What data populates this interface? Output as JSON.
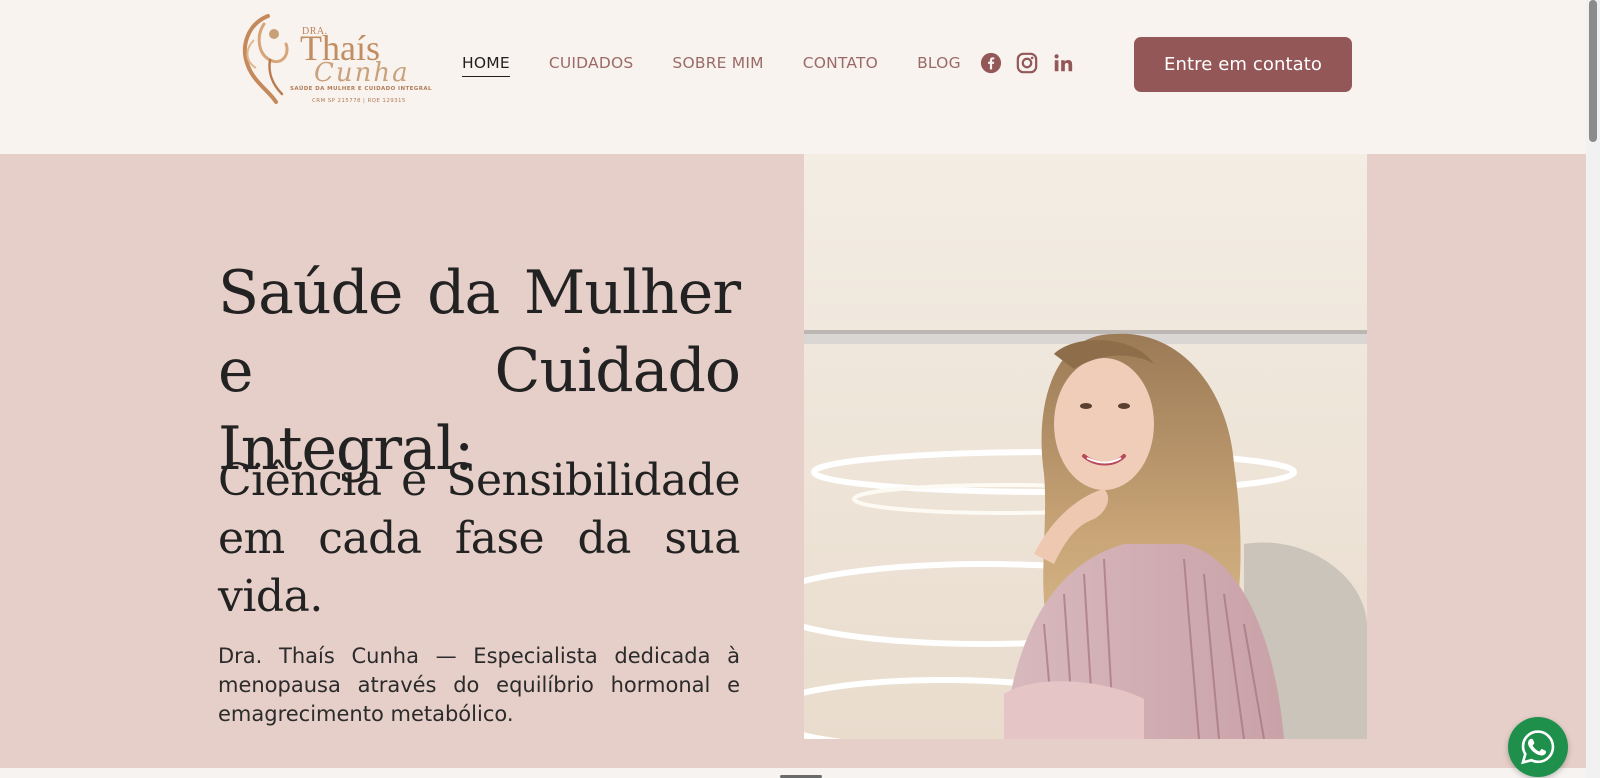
{
  "logo": {
    "prefix": "DRA.",
    "name": "Thaís",
    "surname": "Cunha",
    "tagline": "SAÚDE DA MULHER E CUIDADO INTEGRAL",
    "registration": "CRM SP 215778 | RQE 129315"
  },
  "nav": {
    "items": [
      {
        "label": "HOME",
        "active": true
      },
      {
        "label": "CUIDADOS",
        "active": false
      },
      {
        "label": "SOBRE MIM",
        "active": false
      },
      {
        "label": "CONTATO",
        "active": false
      },
      {
        "label": "BLOG",
        "active": false
      }
    ]
  },
  "socials": [
    "facebook-icon",
    "instagram-icon",
    "linkedin-icon"
  ],
  "header": {
    "cta_label": "Entre em contato"
  },
  "hero": {
    "title": "Saúde da Mulher e Cuidado Integral:",
    "subtitle": "Ciência e Sensibilidade em cada fase da sua vida.",
    "description": "Dra. Thaís Cunha — Especialista dedicada à menopausa através do equilíbrio hormonal e emagrecimento metabólico."
  },
  "colors": {
    "header_bg": "#f9f3f0",
    "hero_bg": "#e6cfc8",
    "accent": "#935758",
    "nav_text": "#9a6b66",
    "whatsapp": "#1f8f4c"
  }
}
